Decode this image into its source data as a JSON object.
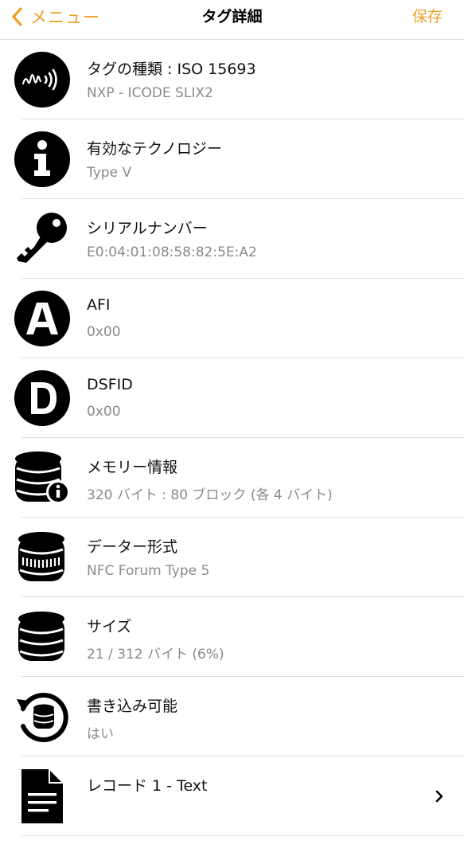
{
  "colors": {
    "accent": "#f0a028"
  },
  "navbar": {
    "back_label": "メニュー",
    "title": "タグ詳細",
    "save_label": "保存"
  },
  "rows": [
    {
      "icon": "nfc-wave-icon",
      "title": "タグの種類 : ISO 15693",
      "subtitle": "NXP - ICODE SLIX2"
    },
    {
      "icon": "info-icon",
      "title": "有効なテクノロジー",
      "subtitle": "Type V"
    },
    {
      "icon": "key-icon",
      "title": "シリアルナンバー",
      "subtitle": "E0:04:01:08:58:82:5E:A2"
    },
    {
      "icon": "letter-a-icon",
      "title": "AFI",
      "subtitle": "0x00"
    },
    {
      "icon": "letter-d-icon",
      "title": "DSFID",
      "subtitle": "0x00"
    },
    {
      "icon": "database-info-icon",
      "title": "メモリー情報",
      "subtitle": "320 バイト : 80 ブロック (各 4 バイト)"
    },
    {
      "icon": "database-format-icon",
      "title": "データー形式",
      "subtitle": "NFC Forum Type 5"
    },
    {
      "icon": "database-icon",
      "title": "サイズ",
      "subtitle": "21 / 312 バイト (6%)"
    },
    {
      "icon": "database-rewrite-icon",
      "title": "書き込み可能",
      "subtitle": "はい"
    },
    {
      "icon": "document-icon",
      "title": "レコード 1 - Text",
      "subtitle": ""
    }
  ]
}
